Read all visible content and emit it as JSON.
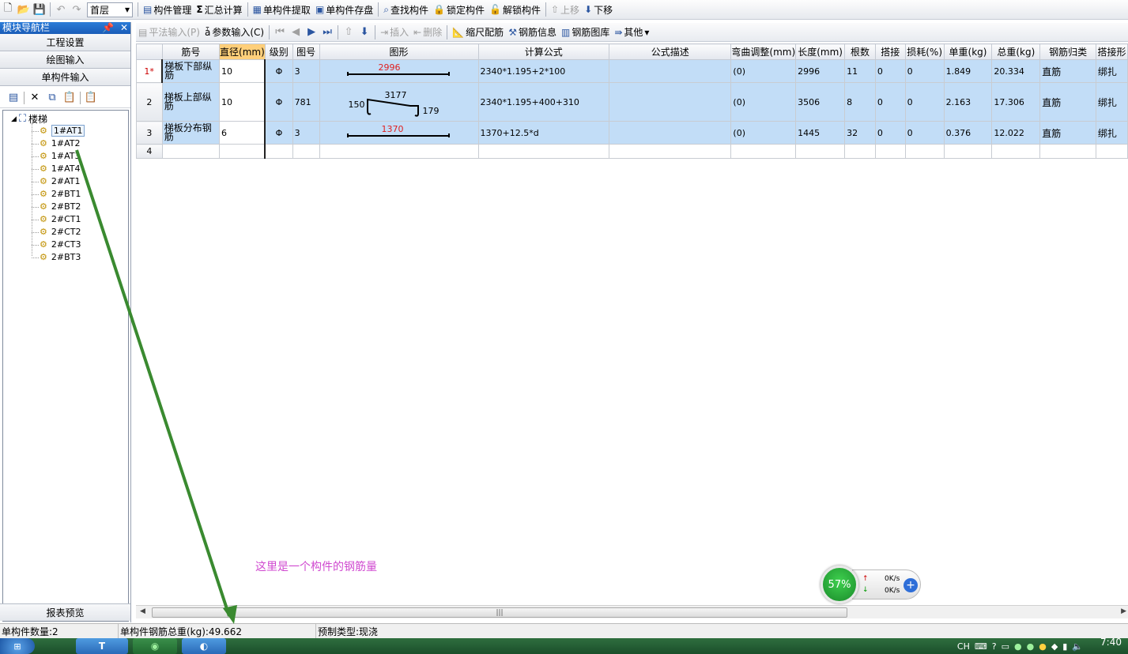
{
  "toolbar": {
    "floor": "首层",
    "buttons": [
      "构件管理",
      "汇总计算",
      "单构件提取",
      "单构件存盘",
      "查找构件",
      "锁定构件",
      "解锁构件",
      "上移",
      "下移"
    ]
  },
  "nav": {
    "title": "模块导航栏",
    "sections": [
      "工程设置",
      "绘图输入",
      "单构件输入"
    ],
    "report": "报表预览",
    "tree": {
      "root": "楼梯",
      "items": [
        "1#AT1",
        "1#AT2",
        "1#AT3",
        "1#AT4",
        "2#AT1",
        "2#BT1",
        "2#BT2",
        "2#CT1",
        "2#CT2",
        "2#CT3",
        "2#BT3"
      ]
    }
  },
  "sub_toolbar": {
    "pingfa": "平法输入(P)",
    "canshu": "参数输入(C)",
    "insert": "插入",
    "delete": "删除",
    "scale": "缩尺配筋",
    "info": "钢筋信息",
    "library": "钢筋图库",
    "other": "其他"
  },
  "grid": {
    "headers": [
      "筋号",
      "直径(mm)",
      "级别",
      "图号",
      "图形",
      "计算公式",
      "公式描述",
      "弯曲调整(mm)",
      "长度(mm)",
      "根数",
      "搭接",
      "损耗(%)",
      "单重(kg)",
      "总重(kg)",
      "钢筋归类",
      "搭接形"
    ],
    "rows": [
      {
        "no": "1*",
        "name": "梯板下部纵筋",
        "dia": "10",
        "grade": "Φ",
        "fig": "3",
        "shape_len": "2996",
        "formula": "2340*1.195+2*100",
        "desc": "",
        "bend": "(0)",
        "length": "2996",
        "count": "11",
        "lap": "0",
        "loss": "0",
        "unit_w": "1.849",
        "total_w": "20.334",
        "cls": "直筋",
        "lap_type": "绑扎"
      },
      {
        "no": "2",
        "name": "梯板上部纵筋",
        "dia": "10",
        "grade": "Φ",
        "fig": "781",
        "shape_a": "150",
        "shape_b": "3177",
        "shape_c": "179",
        "formula": "2340*1.195+400+310",
        "desc": "",
        "bend": "(0)",
        "length": "3506",
        "count": "8",
        "lap": "0",
        "loss": "0",
        "unit_w": "2.163",
        "total_w": "17.306",
        "cls": "直筋",
        "lap_type": "绑扎"
      },
      {
        "no": "3",
        "name": "梯板分布钢筋",
        "dia": "6",
        "grade": "Φ",
        "fig": "3",
        "shape_len": "1370",
        "formula": "1370+12.5*d",
        "desc": "",
        "bend": "(0)",
        "length": "1445",
        "count": "32",
        "lap": "0",
        "loss": "0",
        "unit_w": "0.376",
        "total_w": "12.022",
        "cls": "直筋",
        "lap_type": "绑扎"
      },
      {
        "no": "4"
      }
    ]
  },
  "annotation": "这里是一个构件的钢筋量",
  "speed": {
    "percent": "57%",
    "up": "0K/s",
    "down": "0K/s"
  },
  "status": {
    "count": "单构件数量:2",
    "weight": "单构件钢筋总重(kg):49.662",
    "type": "预制类型:现浇"
  },
  "tray": {
    "lang": "CH",
    "time": "7:40"
  },
  "colors": {
    "arrow": "#3a8a30",
    "annotation": "#d04ad0",
    "highlight": "#c2ddf7",
    "active": "#ffcf7a"
  }
}
